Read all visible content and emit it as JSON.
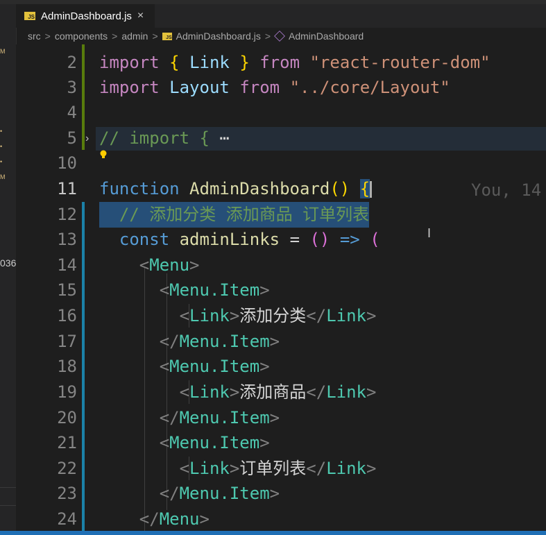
{
  "tab": {
    "title": "AdminDashboard.js",
    "close_glyph": "×",
    "badge": "JS"
  },
  "breadcrumb": {
    "items": [
      "src",
      "components",
      "admin",
      "AdminDashboard.js",
      "AdminDashboard"
    ],
    "separator": ">"
  },
  "left_strip": {
    "fragment": "036"
  },
  "blame": "You, 14",
  "lines": {
    "l2": {
      "num": "2"
    },
    "l3": {
      "num": "3"
    },
    "l4": {
      "num": "4"
    },
    "l5": {
      "num": "5"
    },
    "l10": {
      "num": "10"
    },
    "l11": {
      "num": "11"
    },
    "l12": {
      "num": "12"
    },
    "l13": {
      "num": "13"
    },
    "l14": {
      "num": "14"
    },
    "l15": {
      "num": "15"
    },
    "l16": {
      "num": "16"
    },
    "l17": {
      "num": "17"
    },
    "l18": {
      "num": "18"
    },
    "l19": {
      "num": "19"
    },
    "l20": {
      "num": "20"
    },
    "l21": {
      "num": "21"
    },
    "l22": {
      "num": "22"
    },
    "l23": {
      "num": "23"
    },
    "l24": {
      "num": "24"
    }
  },
  "code": {
    "import": "import",
    "from": "from",
    "lbrace": "{",
    "rbrace": "}",
    "link": "Link",
    "router_str": "\"react-router-dom\"",
    "layout": "Layout",
    "layout_str": "\"../core/Layout\"",
    "import_comment": "// import {",
    "fold_dots": "⋯",
    "function": "function",
    "fn_name": "AdminDashboard",
    "parens": "()",
    "comment12": "// 添加分类 添加商品 订单列表",
    "const": "const",
    "adminLinks": "adminLinks",
    "eq": "=",
    "arrow_parens": "()",
    "arrow": "=>",
    "lparen": "(",
    "menu": "Menu",
    "menu_item": "Menu.Item",
    "text_16": "添加分类",
    "text_19": "添加商品",
    "text_22": "订单列表"
  },
  "colors": {
    "keyword": "#c586c0",
    "storage": "#569cd6",
    "function": "#dcdcaa",
    "variable": "#9cdcfe",
    "string": "#ce9178",
    "comment": "#6a9955",
    "tag": "#4ec9b0",
    "bracket": "#ffd700"
  },
  "icons": {
    "tab_file": "js-file-icon",
    "breadcrumb_symbol": "component-icon",
    "lightbulb": "lightbulb-icon",
    "fold": "chevron-right-icon",
    "text_cursor": "text-cursor-icon"
  }
}
